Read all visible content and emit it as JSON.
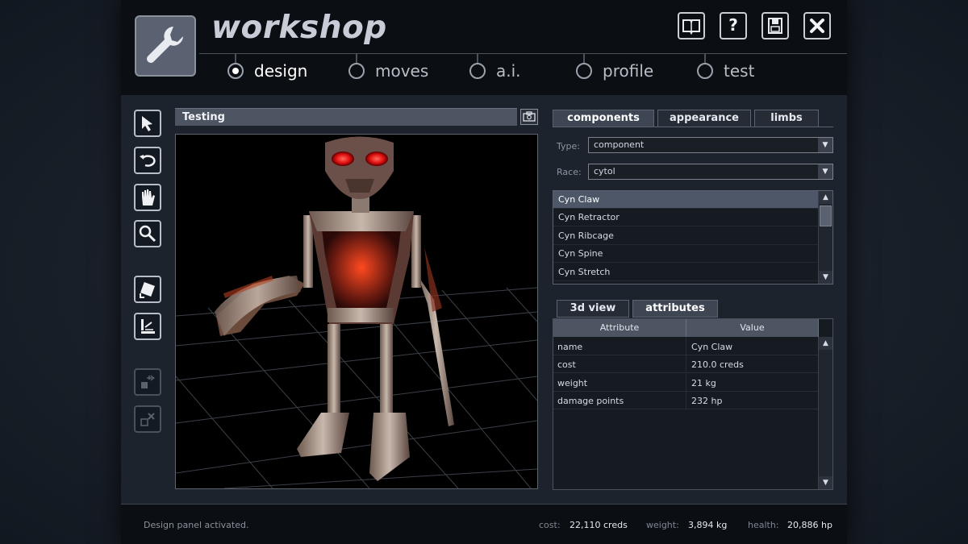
{
  "header": {
    "title": "workshop",
    "buttons": [
      "book-icon",
      "help-icon",
      "save-icon",
      "close-icon"
    ],
    "help_label": "?"
  },
  "modes": [
    {
      "label": "design",
      "active": true
    },
    {
      "label": "moves",
      "active": false
    },
    {
      "label": "a.i.",
      "active": false
    },
    {
      "label": "profile",
      "active": false
    },
    {
      "label": "test",
      "active": false
    }
  ],
  "toolbar": {
    "tools": [
      "select-arrow-icon",
      "rotate-icon",
      "hand-pan-icon",
      "zoom-icon",
      "rotate-part-icon",
      "align-icon",
      "attach-icon",
      "detach-icon"
    ]
  },
  "viewport": {
    "title": "Testing"
  },
  "right_tabs": [
    {
      "label": "components",
      "active": true
    },
    {
      "label": "appearance",
      "active": false
    },
    {
      "label": "limbs",
      "active": false
    }
  ],
  "filters": {
    "type_label": "Type:",
    "type_value": "component",
    "race_label": "Race:",
    "race_value": "cytol"
  },
  "component_list": {
    "items": [
      "Cyn Claw",
      "Cyn Retractor",
      "Cyn Ribcage",
      "Cyn Spine",
      "Cyn Stretch"
    ],
    "selected_index": 0
  },
  "bottom_tabs": [
    {
      "label": "3d view",
      "active": false
    },
    {
      "label": "attributes",
      "active": true
    }
  ],
  "attributes": {
    "columns": [
      "Attribute",
      "Value"
    ],
    "rows": [
      [
        "name",
        "Cyn Claw"
      ],
      [
        "cost",
        "210.0 creds"
      ],
      [
        "weight",
        "21 kg"
      ],
      [
        "damage points",
        "232 hp"
      ]
    ]
  },
  "status": {
    "message": "Design panel activated.",
    "cost_label": "cost:",
    "cost_value": "22,110 creds",
    "weight_label": "weight:",
    "weight_value": "3,894 kg",
    "health_label": "health:",
    "health_value": "20,886 hp"
  },
  "colors": {
    "panel": "#1c232c",
    "header": "#0b0e12",
    "accent": "#4d5563",
    "robot_eyes": "#ff1a1a"
  }
}
